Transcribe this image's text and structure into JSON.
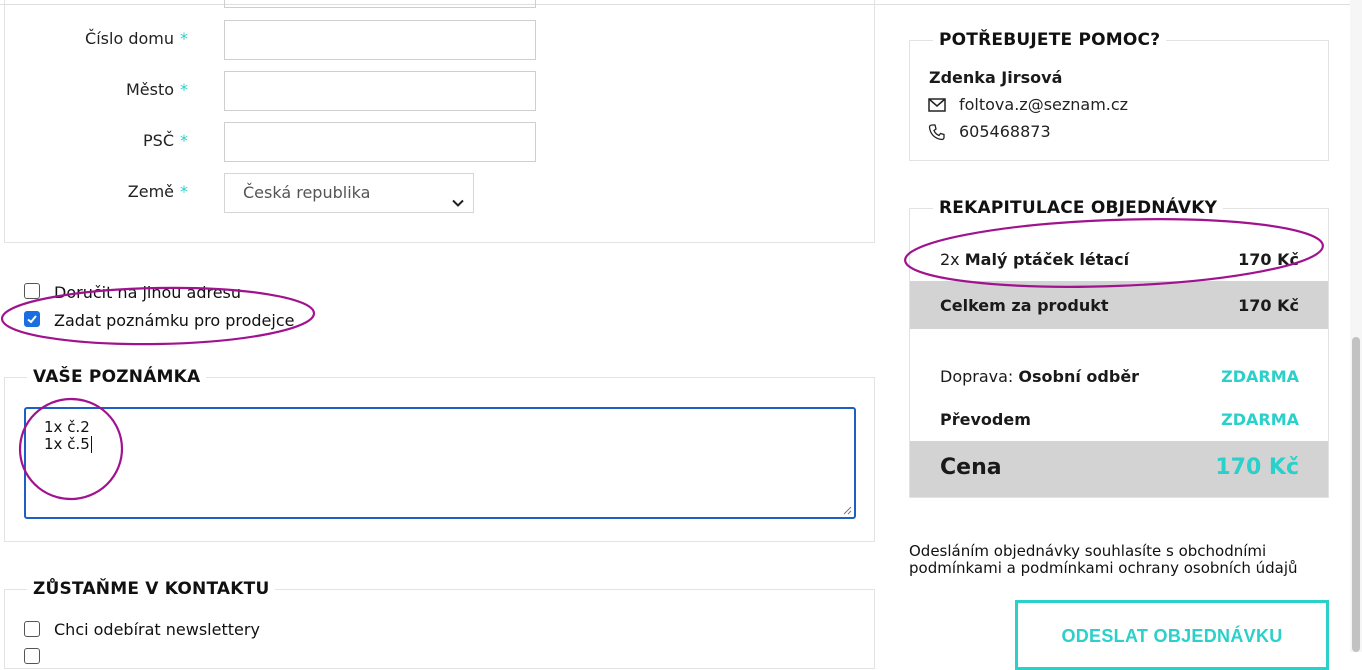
{
  "form": {
    "house_number_label": "Číslo domu",
    "city_label": "Město",
    "zip_label": "PSČ",
    "country_label": "Země",
    "required_mark": "*",
    "country_value": "Česká republika"
  },
  "options": {
    "other_address_label": "Doručit na jinou adresu",
    "other_address_checked": false,
    "seller_note_label": "Zadat poznámku pro prodejce",
    "seller_note_checked": true
  },
  "note": {
    "heading": "VAŠE POZNÁMKA",
    "lines": [
      "1x č.2",
      "1x č.5"
    ]
  },
  "contact": {
    "heading": "ZŮSTAŇME V KONTAKTU",
    "newsletter_label": "Chci odebírat newslettery"
  },
  "help": {
    "heading": "POTŘEBUJETE POMOC?",
    "name": "Zdenka Jirsová",
    "email": "foltova.z@seznam.cz",
    "phone": "605468873"
  },
  "recap": {
    "heading": "REKAPITULACE OBJEDNÁVKY",
    "item_qty": "2x",
    "item_name": "Malý ptáček létací",
    "item_price": "170 Kč",
    "product_total_label": "Celkem za produkt",
    "product_total": "170 Kč",
    "shipping_label": "Doprava:",
    "shipping_method": "Osobní odběr",
    "shipping_price": "ZDARMA",
    "payment_label": "Převodem",
    "payment_price": "ZDARMA",
    "total_label": "Cena",
    "total": "170 Kč"
  },
  "terms_text": "Odesláním objednávky souhlasíte s obchodními podmínkami a podmínkami ochrany osobních údajů",
  "submit_label": "ODESLAT OBJEDNÁVKU",
  "colors": {
    "accent": "#2ad0c9",
    "focus_blue": "#1f5fc4",
    "checkbox_blue": "#1a6fe0",
    "annotation_magenta": "#a0138f"
  },
  "icons": [
    "mail-icon",
    "phone-icon",
    "chevron-down-icon",
    "checkmark-icon"
  ]
}
